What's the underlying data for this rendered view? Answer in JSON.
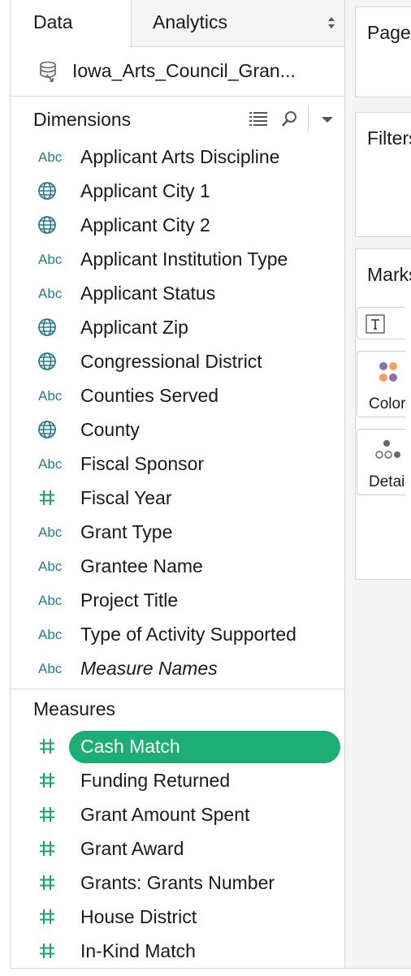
{
  "tabs": {
    "data": "Data",
    "analytics": "Analytics"
  },
  "datasource": {
    "name": "Iowa_Arts_Council_Gran...",
    "icon": "database-icon"
  },
  "dimensions": {
    "header": "Dimensions",
    "items": [
      {
        "type": "abc",
        "label": "Applicant Arts Discipline"
      },
      {
        "type": "geo",
        "label": "Applicant City 1"
      },
      {
        "type": "geo",
        "label": "Applicant City 2"
      },
      {
        "type": "abc",
        "label": "Applicant Institution Type"
      },
      {
        "type": "abc",
        "label": "Applicant Status"
      },
      {
        "type": "geo",
        "label": "Applicant Zip"
      },
      {
        "type": "geo",
        "label": "Congressional District"
      },
      {
        "type": "abc",
        "label": "Counties Served"
      },
      {
        "type": "geo",
        "label": "County"
      },
      {
        "type": "abc",
        "label": "Fiscal Sponsor"
      },
      {
        "type": "num",
        "label": "Fiscal Year"
      },
      {
        "type": "abc",
        "label": "Grant Type"
      },
      {
        "type": "abc",
        "label": "Grantee Name"
      },
      {
        "type": "abc",
        "label": "Project Title"
      },
      {
        "type": "abc",
        "label": "Type of Activity Supported"
      },
      {
        "type": "abc",
        "label": "Measure Names",
        "italic": true
      }
    ]
  },
  "measures": {
    "header": "Measures",
    "items": [
      {
        "type": "num",
        "label": "Cash Match",
        "selected": true
      },
      {
        "type": "num",
        "label": "Funding Returned"
      },
      {
        "type": "num",
        "label": "Grant Amount Spent"
      },
      {
        "type": "num",
        "label": "Grant Award"
      },
      {
        "type": "num",
        "label": "Grants: Grants Number"
      },
      {
        "type": "num",
        "label": "House District"
      },
      {
        "type": "num",
        "label": "In-Kind Match"
      }
    ]
  },
  "abc_text": "Abc",
  "shelves": {
    "pages": "Pages",
    "filters": "Filters",
    "marks": "Marks",
    "color": "Color",
    "detail": "Detail"
  },
  "colors": {
    "accent_green": "#1dae76",
    "abc_teal": "#2b7a8c",
    "geo_teal": "#2b7a8c",
    "measure_green": "#1aa370",
    "mark_purple": "#8c6fa5",
    "mark_orange": "#f2a25c"
  }
}
